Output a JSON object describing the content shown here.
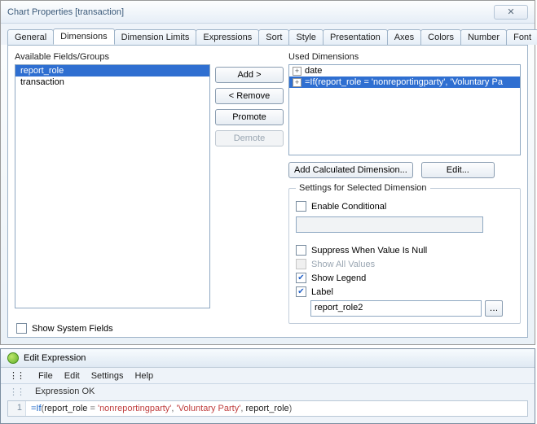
{
  "main_window": {
    "title": "Chart Properties [transaction]",
    "tabs": [
      "General",
      "Dimensions",
      "Dimension Limits",
      "Expressions",
      "Sort",
      "Style",
      "Presentation",
      "Axes",
      "Colors",
      "Number",
      "Font"
    ],
    "active_tab_index": 1,
    "scroll_left": "◄",
    "scroll_right": "►",
    "close_glyph": "✕"
  },
  "available": {
    "label": "Available Fields/Groups",
    "items": [
      "report_role",
      "transaction"
    ],
    "selected_index": 0
  },
  "buttons": {
    "add": "Add >",
    "remove": "< Remove",
    "promote": "Promote",
    "demote": "Demote",
    "add_calc": "Add Calculated Dimension...",
    "edit": "Edit..."
  },
  "used": {
    "label": "Used Dimensions",
    "items": [
      {
        "text": "date",
        "selected": false
      },
      {
        "text": "=If(report_role = 'nonreportingparty', 'Voluntary Pa",
        "selected": true
      }
    ]
  },
  "settings": {
    "legend": "Settings for Selected Dimension",
    "enable_conditional": {
      "label": "Enable Conditional",
      "checked": false
    },
    "suppress_null": {
      "label": "Suppress When Value Is Null",
      "checked": false
    },
    "show_all": {
      "label": "Show All Values",
      "checked": false,
      "disabled": true
    },
    "show_legend": {
      "label": "Show Legend",
      "checked": true
    },
    "label_chk": {
      "label": "Label",
      "checked": true
    },
    "label_value": "report_role2"
  },
  "sysfields": {
    "label": "Show System Fields",
    "checked": false
  },
  "expr_window": {
    "title": "Edit Expression",
    "menu": [
      "File",
      "Edit",
      "Settings",
      "Help"
    ],
    "status": "Expression OK",
    "line_no": "1",
    "code": {
      "fn_if": "=If",
      "open": "(",
      "id1": "report_role ",
      "eq": "= ",
      "str1": "'nonreportingparty'",
      "c1": ", ",
      "str2": "'Voluntary Party'",
      "c2": ", ",
      "id2": "report_role",
      "close": ")"
    }
  }
}
